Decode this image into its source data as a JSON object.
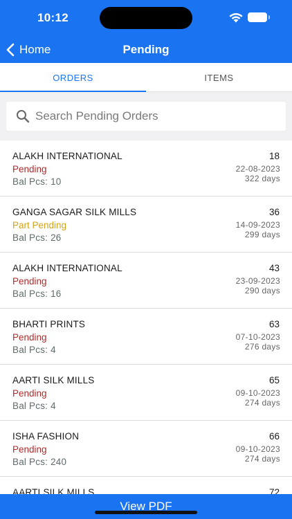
{
  "status_bar": {
    "time": "10:12"
  },
  "nav": {
    "back_label": "Home",
    "title": "Pending"
  },
  "tabs": [
    {
      "label": "ORDERS",
      "selected": true
    },
    {
      "label": "ITEMS",
      "selected": false
    }
  ],
  "search": {
    "placeholder": "Search Pending Orders"
  },
  "colors": {
    "primary": "#1a73f0",
    "pending": "#b02a2a",
    "part_pending": "#d4a21a"
  },
  "orders": [
    {
      "name": "ALAKH INTERNATIONAL",
      "status": "Pending",
      "bal": "Bal Pcs: 10",
      "number": "18",
      "date": "22-08-2023",
      "days": "322 days"
    },
    {
      "name": "GANGA SAGAR SILK MILLS",
      "status": "Part Pending",
      "bal": "Bal Pcs: 26",
      "number": "36",
      "date": "14-09-2023",
      "days": "299 days"
    },
    {
      "name": "ALAKH INTERNATIONAL",
      "status": "Pending",
      "bal": "Bal Pcs: 16",
      "number": "43",
      "date": "23-09-2023",
      "days": "290 days"
    },
    {
      "name": "BHARTI PRINTS",
      "status": "Pending",
      "bal": "Bal Pcs: 4",
      "number": "63",
      "date": "07-10-2023",
      "days": "276 days"
    },
    {
      "name": "AARTI SILK MILLS",
      "status": "Pending",
      "bal": "Bal Pcs: 4",
      "number": "65",
      "date": "09-10-2023",
      "days": "274 days"
    },
    {
      "name": "ISHA FASHION",
      "status": "Pending",
      "bal": "Bal Pcs: 240",
      "number": "66",
      "date": "09-10-2023",
      "days": "274 days"
    },
    {
      "name": "AARTI SILK MILLS",
      "status": "",
      "bal": "",
      "number": "72",
      "date": "",
      "days": ""
    }
  ],
  "footer": {
    "button_label": "View PDF"
  }
}
